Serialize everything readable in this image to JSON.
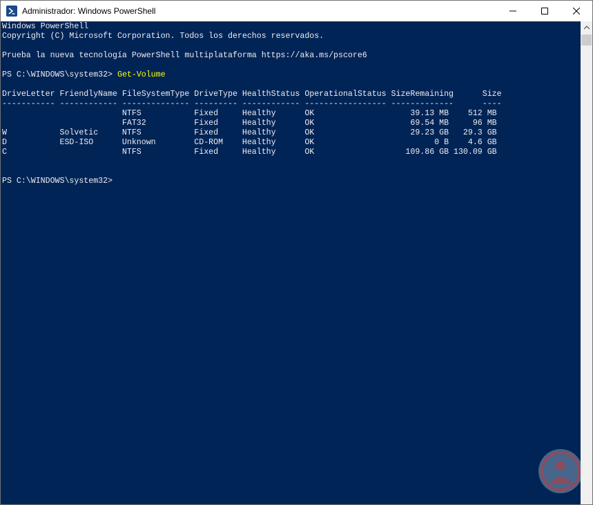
{
  "window": {
    "title": "Administrador: Windows PowerShell"
  },
  "console": {
    "header1": "Windows PowerShell",
    "header2": "Copyright (C) Microsoft Corporation. Todos los derechos reservados.",
    "header3": "Prueba la nueva tecnología PowerShell multiplataforma https://aka.ms/pscore6",
    "prompt": "PS C:\\WINDOWS\\system32> ",
    "command": "Get-Volume",
    "table_header": "DriveLetter FriendlyName FileSystemType DriveType HealthStatus OperationalStatus SizeRemaining      Size",
    "table_separator": "----------- ------------ -------------- --------- ------------ ----------------- -------------      ----",
    "rows": [
      "                         NTFS           Fixed     Healthy      OK                    39.13 MB    512 MB",
      "                         FAT32          Fixed     Healthy      OK                    69.54 MB     96 MB",
      "W           Solvetic     NTFS           Fixed     Healthy      OK                    29.23 GB   29.3 GB",
      "D           ESD-ISO      Unknown        CD-ROM    Healthy      OK                         0 B    4.6 GB",
      "C                        NTFS           Fixed     Healthy      OK                   109.86 GB 130.09 GB"
    ],
    "final_prompt": "PS C:\\WINDOWS\\system32>"
  },
  "icons": {
    "app": "powershell-icon",
    "minimize": "minimize-icon",
    "maximize": "maximize-icon",
    "close": "close-icon",
    "watermark": "solvetic-logo"
  },
  "colors": {
    "console_bg": "#012456",
    "console_text": "#eeedf0",
    "command_text": "#ffff00"
  }
}
